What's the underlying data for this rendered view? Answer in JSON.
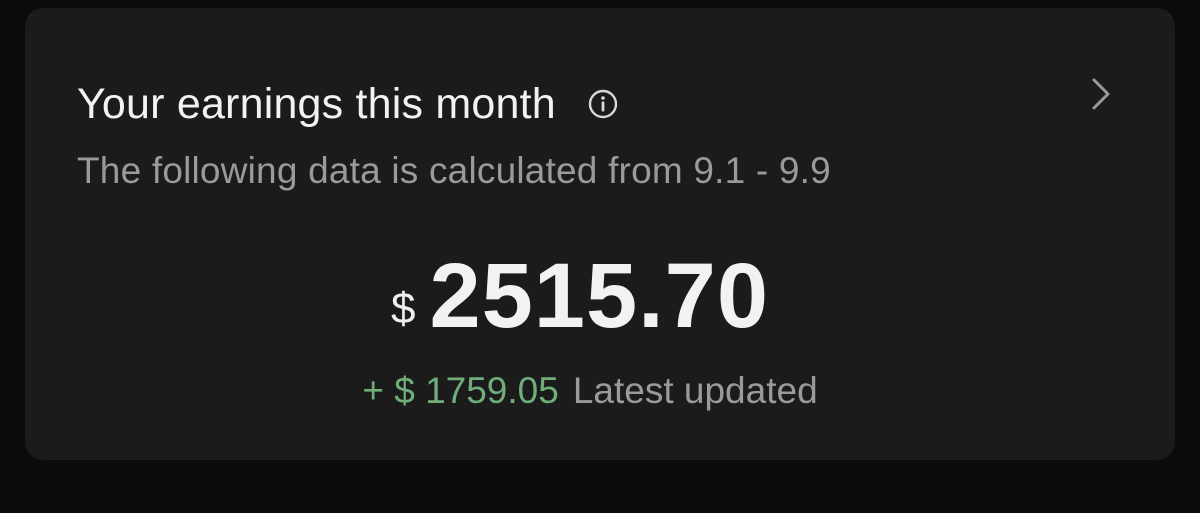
{
  "card": {
    "title": "Your earnings this month",
    "info_icon": "info-circle-icon",
    "chevron_icon": "chevron-right-icon",
    "subtitle": "The following data is calculated from 9.1 - 9.9",
    "currency_symbol": "$",
    "amount": "2515.70",
    "delta": "+ $ 1759.05",
    "delta_label": "Latest updated"
  },
  "colors": {
    "background": "#0b0b0b",
    "card": "#1b1b1b",
    "text_primary": "#f2f2f2",
    "text_secondary": "#9a9a9a",
    "positive": "#6fae7a"
  }
}
